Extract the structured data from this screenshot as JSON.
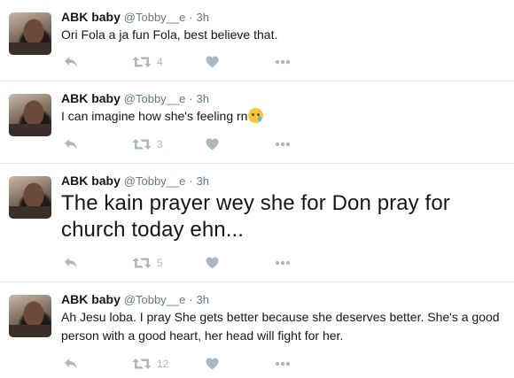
{
  "tweets": [
    {
      "name": "ABK baby",
      "handle": "@Tobby__e",
      "dot": "·",
      "time": "3h",
      "text": "Ori Fola a ja fun Fola, best believe that.",
      "emoji": "",
      "retweets": "4",
      "likes": ""
    },
    {
      "name": "ABK baby",
      "handle": "@Tobby__e",
      "dot": "·",
      "time": "3h",
      "text": "I can imagine how she's feeling rn",
      "emoji": "crying-face-emoji",
      "retweets": "3",
      "likes": ""
    },
    {
      "name": "ABK baby",
      "handle": "@Tobby__e",
      "dot": "·",
      "time": "3h",
      "text": "The kain prayer wey she for Don pray for church today ehn...",
      "emoji": "",
      "retweets": "5",
      "likes": ""
    },
    {
      "name": "ABK baby",
      "handle": "@Tobby__e",
      "dot": "·",
      "time": "3h",
      "text": "Ah Jesu loba. I pray She gets better because she deserves better. She's a good person with a good heart, her head will fight for her.",
      "emoji": "",
      "retweets": "12",
      "likes": ""
    }
  ],
  "icons": {
    "reply": "reply-icon",
    "retweet": "retweet-icon",
    "like": "heart-icon",
    "more": "more-icon"
  },
  "colors": {
    "name": "#14171a",
    "meta": "#657786",
    "action": "#aab8c2",
    "divider": "#e6ecf0"
  }
}
